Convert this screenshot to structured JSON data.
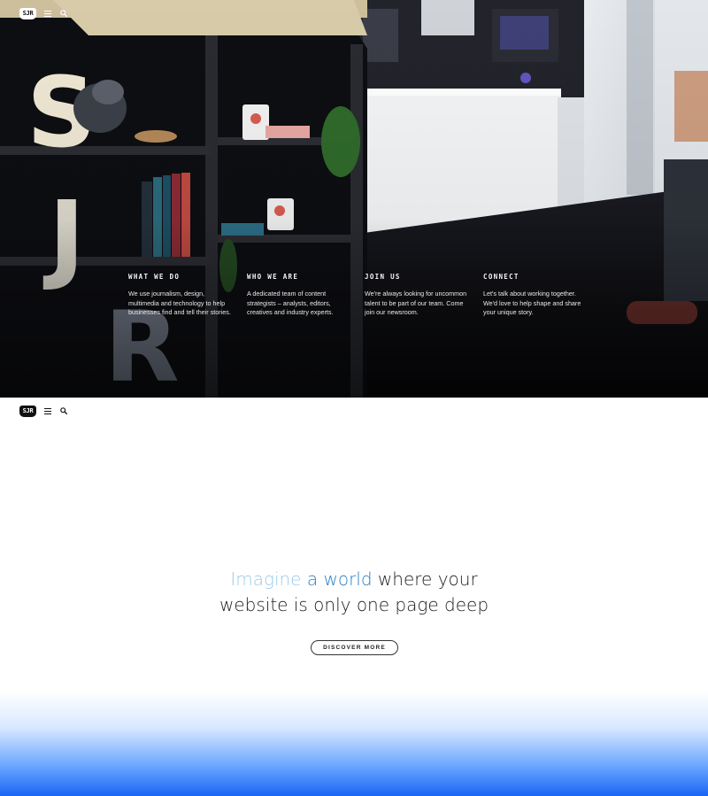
{
  "brand": {
    "logo_text": "SJR"
  },
  "hero": {
    "features": [
      {
        "title": "What We Do",
        "text": "We use journalism, design, multimedia and technology to help businesses find and tell their stories."
      },
      {
        "title": "Who We Are",
        "text": "A dedicated team of content strategists – analysts, editors, creatives and industry experts."
      },
      {
        "title": "Join Us",
        "text": "We're always looking for uncommon talent to be part of our team. Come join our newsroom."
      },
      {
        "title": "Connect",
        "text": "Let's talk about working together. We'd love to help shape and share your unique story."
      }
    ]
  },
  "main": {
    "headline_part1": "Imagine",
    "headline_part2": "a world",
    "headline_part3": "where your",
    "headline_line2": "website is only one page deep",
    "cta_label": "DISCOVER MORE"
  },
  "icons": [
    "menu-icon",
    "search-icon"
  ],
  "colors": {
    "accent_light": "#9ccbe8",
    "accent": "#2a7dc6",
    "gradient_blue": "#1a66f5"
  }
}
